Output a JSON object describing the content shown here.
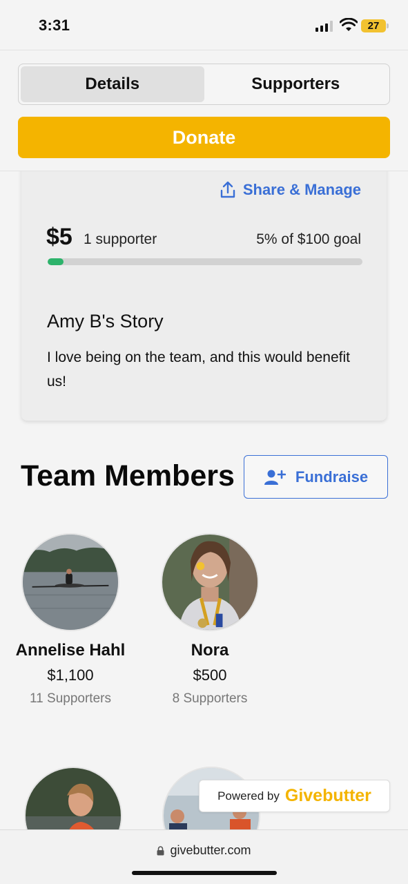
{
  "status_bar": {
    "time": "3:31",
    "battery": "27"
  },
  "tabs": [
    {
      "label": "Details",
      "active": true
    },
    {
      "label": "Supporters",
      "active": false
    }
  ],
  "donate_label": "Donate",
  "campaign": {
    "share_label": "Share & Manage",
    "raised": "$5",
    "supporters": "1 supporter",
    "goal_text": "5% of $100 goal",
    "progress_percent": 5,
    "story_title": "Amy B's Story",
    "story_text": "I love being on the team, and this would benefit us!"
  },
  "team": {
    "title": "Team Members",
    "fundraise_label": "Fundraise",
    "members": [
      {
        "name": "Annelise Hahl",
        "amount": "$1,100",
        "supporters": "11 Supporters"
      },
      {
        "name": "Nora",
        "amount": "$500",
        "supporters": "8 Supporters"
      }
    ]
  },
  "powered": {
    "prefix": "Powered by",
    "brand": "Givebutter"
  },
  "browser": {
    "url": "givebutter.com"
  },
  "colors": {
    "accent": "#f4b400",
    "link": "#3a6fd6",
    "progress": "#2db36b"
  }
}
